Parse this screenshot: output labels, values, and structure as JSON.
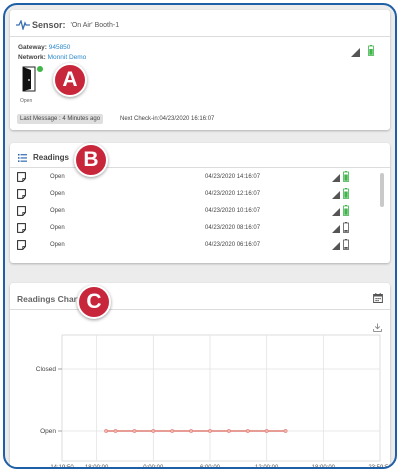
{
  "sensor": {
    "label": "Sensor:",
    "name": "'On Air' Booth-1",
    "gateway_label": "Gateway:",
    "gateway_value": "945850",
    "network_label": "Network:",
    "network_value": "Monnit Demo",
    "state": "Open",
    "last_message": "Last Message : 4 Minutes ago",
    "next_checkin": "Next Check-in:04/23/2020 16:16:07",
    "status_color": "#3fb54a"
  },
  "readings": {
    "title": "Readings",
    "rows": [
      {
        "state": "Open",
        "time": "04/23/2020 14:16:07",
        "battery": "green"
      },
      {
        "state": "Open",
        "time": "04/23/2020 12:16:07",
        "battery": "green"
      },
      {
        "state": "Open",
        "time": "04/23/2020 10:16:07",
        "battery": "green"
      },
      {
        "state": "Open",
        "time": "04/23/2020 08:16:07",
        "battery": "gray"
      },
      {
        "state": "Open",
        "time": "04/23/2020 06:16:07",
        "battery": "gray"
      }
    ]
  },
  "chart": {
    "title": "Readings Chart"
  },
  "chart_data": {
    "type": "line",
    "title": "Readings Chart",
    "y_categories": [
      "Open",
      "Closed"
    ],
    "x_ticks": [
      "14:19:50",
      "18:00:00",
      "0:00:00",
      "6:00:00",
      "12:00:00",
      "18:00:00",
      "23:59:59"
    ],
    "xlim": [
      "14:19:50",
      "23:59:59"
    ],
    "series": [
      {
        "x": [
          "19:00",
          "20:00",
          "22:00",
          "0:00",
          "2:00",
          "4:00",
          "6:00",
          "8:00",
          "10:00",
          "12:00",
          "14:00"
        ],
        "values": [
          "Open",
          "Open",
          "Open",
          "Open",
          "Open",
          "Open",
          "Open",
          "Open",
          "Open",
          "Open",
          "Open"
        ],
        "color": "#e07b73"
      }
    ],
    "grid": true
  },
  "callouts": [
    "A",
    "B",
    "C"
  ],
  "colors": {
    "frame": "#1f5fa8",
    "badge": "#c8263a",
    "link": "#2a88c8",
    "battery_green": "#3fb54a"
  }
}
